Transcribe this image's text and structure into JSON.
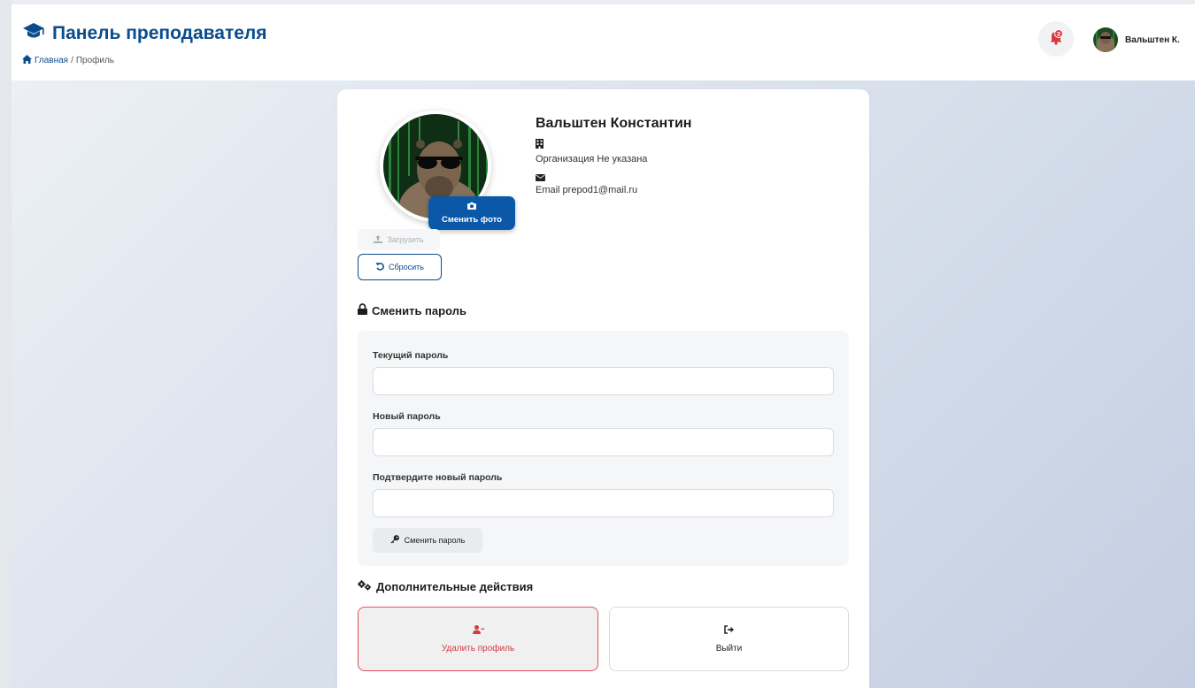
{
  "header": {
    "title": "Панель преподавателя",
    "breadcrumb": {
      "home": "Главная",
      "separator": "/",
      "current": "Профиль"
    },
    "notifications_count": "2",
    "user_short_name": "Вальштен К."
  },
  "profile": {
    "full_name": "Вальштен Константин",
    "organization_line": "Организация Не указана",
    "email_line": "Email prepod1@mail.ru",
    "change_photo_label": "Сменить фото",
    "upload_label": "Загрузить",
    "reset_label": "Сбросить"
  },
  "password_section": {
    "title": "Сменить пароль",
    "current_label": "Текущий пароль",
    "current_value": "",
    "new_label": "Новый пароль",
    "new_value": "",
    "confirm_label": "Подтвердите новый пароль",
    "confirm_value": "",
    "submit_label": "Сменить пароль"
  },
  "extra_section": {
    "title": "Дополнительные действия",
    "delete_label": "Удалить профиль",
    "logout_label": "Выйти"
  },
  "colors": {
    "brand": "#0b4c8c",
    "photo_button": "#0b57a8",
    "danger": "#d13b45",
    "badge": "#e5393f"
  },
  "icons": {
    "brand": "graduation-cap-icon",
    "home": "home-icon",
    "notification": "bell-icon",
    "camera": "camera-icon",
    "upload": "upload-icon",
    "reset": "undo-icon",
    "organization": "building-icon",
    "email": "envelope-icon",
    "lock": "lock-icon",
    "key": "key-icon",
    "gears": "gears-icon",
    "delete": "user-minus-icon",
    "logout": "sign-out-icon"
  }
}
